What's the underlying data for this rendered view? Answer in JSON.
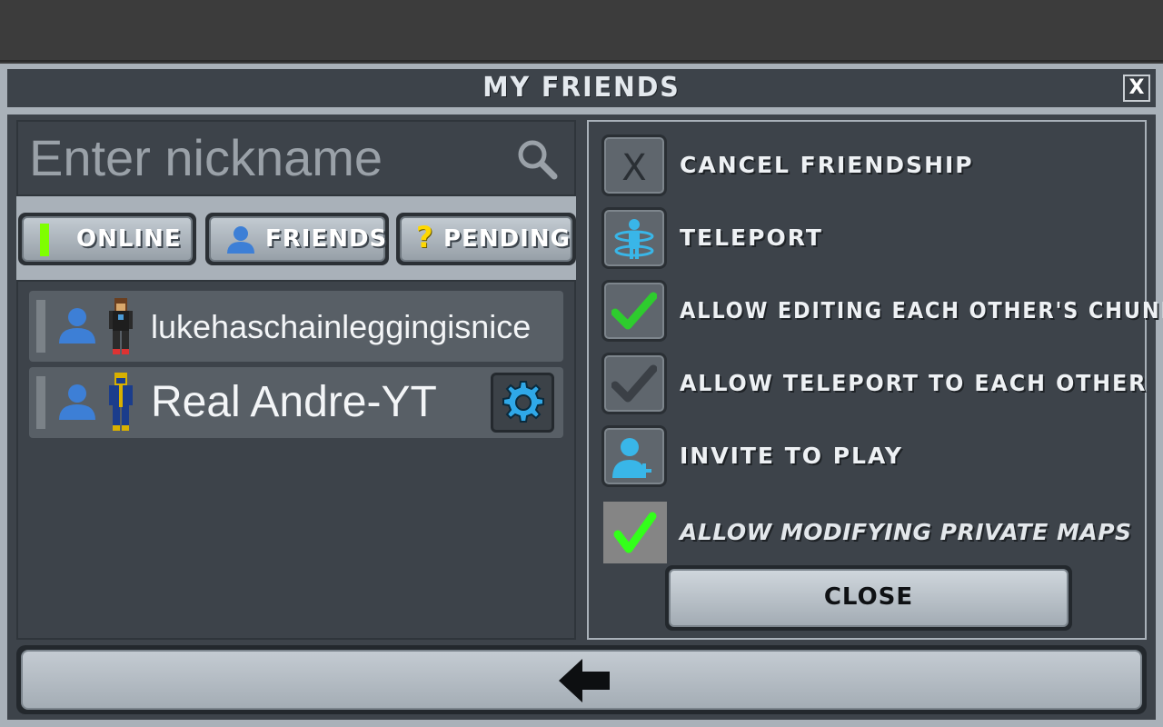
{
  "dialog": {
    "title": "MY FRIENDS",
    "close_glyph": "X"
  },
  "search": {
    "placeholder": "Enter nickname",
    "icon": "search-icon"
  },
  "filters": [
    {
      "label": "ONLINE",
      "icon": "online-indicator",
      "color": "#7fff00"
    },
    {
      "label": "FRIENDS",
      "icon": "person-icon",
      "color": "#3d7fd6"
    },
    {
      "label": "PENDING",
      "icon": "question-icon",
      "color": "#ffd800"
    }
  ],
  "friends": [
    {
      "name": "lukehaschainleggingisnice",
      "avatar": "person-icon",
      "skin": "player-skin-icon",
      "has_settings": false
    },
    {
      "name": "Real Andre-YT",
      "avatar": "person-icon",
      "skin": "player-skin-icon",
      "has_settings": true,
      "settings_icon": "gear-icon"
    }
  ],
  "actions": [
    {
      "label": "CANCEL FRIENDSHIP",
      "icon": "x-icon"
    },
    {
      "label": "TELEPORT",
      "icon": "teleport-icon"
    },
    {
      "label": "ALLOW EDITING EACH OTHER'S CHUNKS",
      "icon": "check-icon",
      "checked": true,
      "check_color": "#2ecc2e"
    },
    {
      "label": "ALLOW TELEPORT TO EACH OTHER",
      "icon": "check-icon",
      "checked": false,
      "check_color": "#3b4046"
    },
    {
      "label": "INVITE TO PLAY",
      "icon": "add-person-icon"
    }
  ],
  "private_maps": {
    "label": "ALLOW MODIFYING PRIVATE MAPS",
    "checked": true,
    "check_color": "#33ff1a"
  },
  "close_button": {
    "label": "CLOSE"
  },
  "back_button": {
    "icon": "back-arrow-icon"
  }
}
